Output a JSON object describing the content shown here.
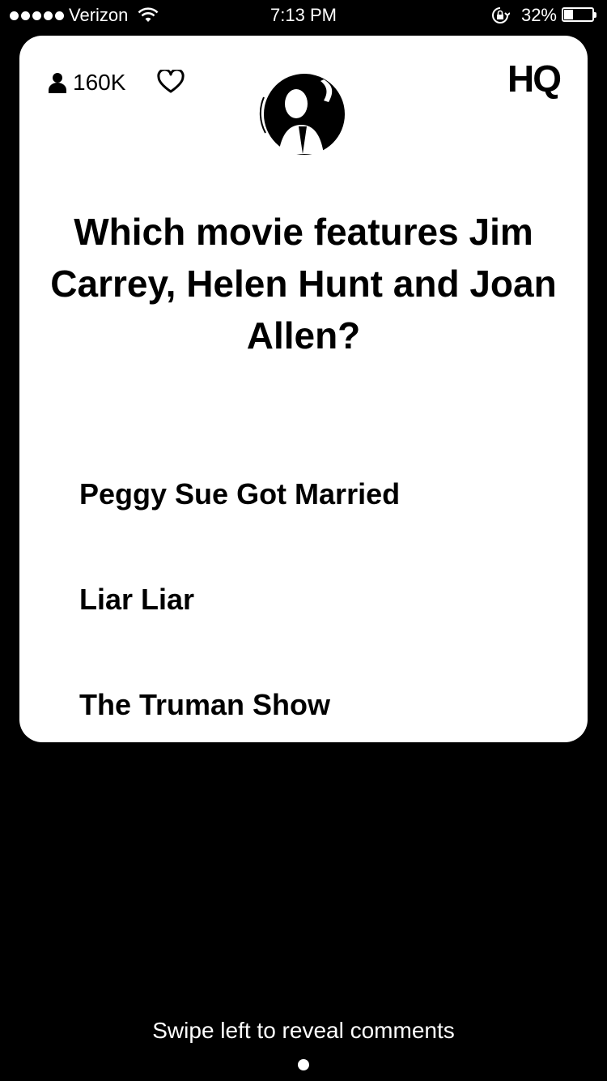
{
  "status_bar": {
    "carrier": "Verizon",
    "time": "7:13 PM",
    "battery_percent_text": "32%",
    "battery_level": 0.32,
    "icons": [
      "signal-dots",
      "wifi-icon",
      "rotation-lock-icon",
      "battery-icon"
    ]
  },
  "game": {
    "viewer_count": "160K",
    "logo": "HQ",
    "question": "Which movie features Jim Carrey, Helen Hunt and Joan Allen?",
    "answers": [
      {
        "label": "Peggy Sue Got Married"
      },
      {
        "label": "Liar Liar"
      },
      {
        "label": "The Truman Show"
      }
    ],
    "icons": [
      "person-icon",
      "heart-icon",
      "host-avatar"
    ]
  },
  "footer": {
    "swipe_hint": "Swipe left to reveal comments"
  },
  "colors": {
    "background": "#000000",
    "card": "#ffffff",
    "text_dark": "#000000",
    "text_light": "#ffffff"
  }
}
